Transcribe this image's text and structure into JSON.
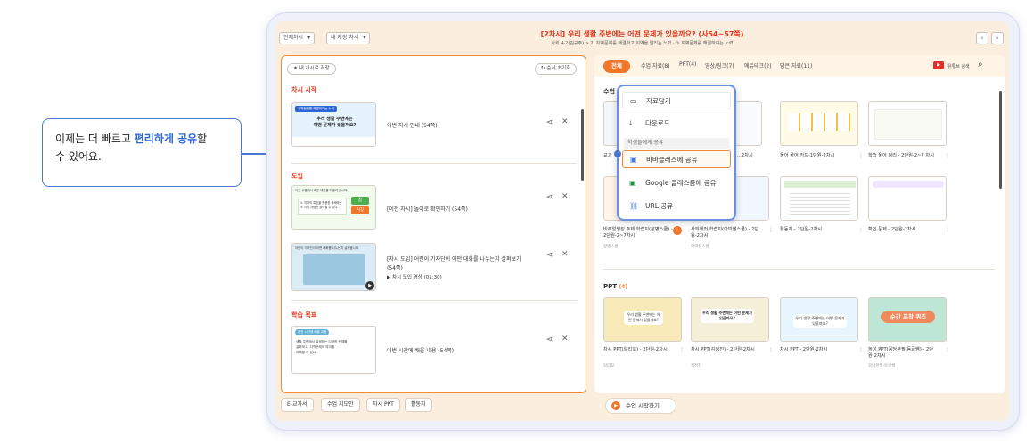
{
  "callout": {
    "line1_pre": "이제는 더 빠르고 ",
    "line1_hl": "편리하게 공유",
    "line1_post": "할",
    "line2": "수 있어요."
  },
  "header": {
    "dropdown1": "전체차시",
    "dropdown2": "내 저장 차시",
    "title": "[2차시] 우리 생활 주변에는 어떤 문제가 있을까요? (사54~57쪽)",
    "breadcrumb": "사회 4-2(김규주) > 2. 지역문제를 해결하고 지역을 알리는 노력 · ① 지역문제를 해결하려는 노력",
    "prev": "‹",
    "next": "›"
  },
  "left": {
    "save_label": "내 차시로 저장",
    "reset_label": "순서 초기화",
    "sections": {
      "s1": "차시 시작",
      "s2": "도입",
      "s3": "학습 목표"
    },
    "items": {
      "i1": "이번 차시 안내 (54쪽)",
      "i2": "[이전 차시] 놀이로 확인하기 (54쪽)",
      "i3_title": "[차시 도입] 어린이 기자단이 어떤 대화를 나누는지 살펴보기",
      "i3_page": "(54쪽)",
      "i3_video": "▶ 차시 도입 영상 (01:30)",
      "i4": "이번 시간에 배울 내용 (54쪽)"
    },
    "thumb_texts": {
      "t1_head": "지역문제를 해결하려는 노력",
      "t1_body": "우리 생활 주변에는\n어떤 문제가 있을까요?",
      "t2_head": "이전 수업에서 배운 내용을 떠올려 봅시다.",
      "t2_q": "① 지역의 특징을 활용한 축제에는\n② 지역 사람만 참여할 수 있다.",
      "t2_ok": "참",
      "t2_no": "거짓",
      "t3_head": "어린이 기자단이 어떤 대화를 나누는지 살펴봅시다.",
      "t4_head": "이번 시간에 배울 내용",
      "t4_body": "생활 주변에서 발생하는 다양한 문제를\n살펴보고, 지역문제의 의미를\n이해할 수 있다."
    }
  },
  "bottom_tabs": [
    "E-교과서",
    "수업 지도안",
    "차시 PPT",
    "활동지"
  ],
  "start_button": "수업 시작하기",
  "right": {
    "tabs": [
      "전체",
      "수업 자료(8)",
      "PPT(4)",
      "영상/링크(7)",
      "에듀테크(2)",
      "담은 자료(11)"
    ],
    "youtube_label": "유튜브 검색",
    "section1_title": "수업",
    "section2_title": "PPT",
    "section2_count": "(4)",
    "row1": [
      {
        "cap": "교과",
        "sub": ""
      },
      {
        "cap": "...2차시",
        "sub": ""
      },
      {
        "cap": "울어 울어 카드-1단원-2차시",
        "sub": ""
      },
      {
        "cap": "학습 울어 정리 - 2단원-2~7 차시",
        "sub": ""
      }
    ],
    "row2": [
      {
        "cap": "비주얼씽킹 주제 학습지(장병스쿨) - 2단원-2~7차시",
        "sub": "장병스쿨"
      },
      {
        "cap": "사회내컷 학습지(아띠쌤스쿨) - 2단원-2차시",
        "sub": "아띠쌤스쿨"
      },
      {
        "cap": "활동지 - 2단원-2차시",
        "sub": ""
      },
      {
        "cap": "확인 문제 - 2단원-2차시",
        "sub": ""
      }
    ],
    "row3": [
      {
        "cap": "차시 PPT(알리꼬) - 2단원-2차시",
        "sub": "알리꼬"
      },
      {
        "cap": "차시 PPT(김정진) - 2단원-2차시",
        "sub": "김정진"
      },
      {
        "cap": "차시 PPT - 2단원-2차시",
        "sub": ""
      },
      {
        "cap": "놀이 PPT(몽당분필·동글쌤) - 2단원-2차시",
        "sub": "몽당분필·동글쌤"
      }
    ],
    "ppt_thumbs": {
      "p1": "우리 생활 주변에는 어떤 문제가 있을까요?",
      "p2": "우리 생활 주변에는 어떤 문제가 있을까요?",
      "p3": "우리 생활 주변에는 어떤 문제가 있을까요?",
      "p4": "순간 포착 퀴즈"
    }
  },
  "popup": {
    "item1": "자료담기",
    "item2": "다운로드",
    "share_header": "학생들에게 공유",
    "item3": "비바클래스에 공유",
    "item4": "Google 클래스룸에 공유",
    "item5": "URL 공유"
  },
  "colors": {
    "accent_orange": "#f0762a",
    "title_red": "#e2331a",
    "callout_blue": "#4a78d0"
  }
}
